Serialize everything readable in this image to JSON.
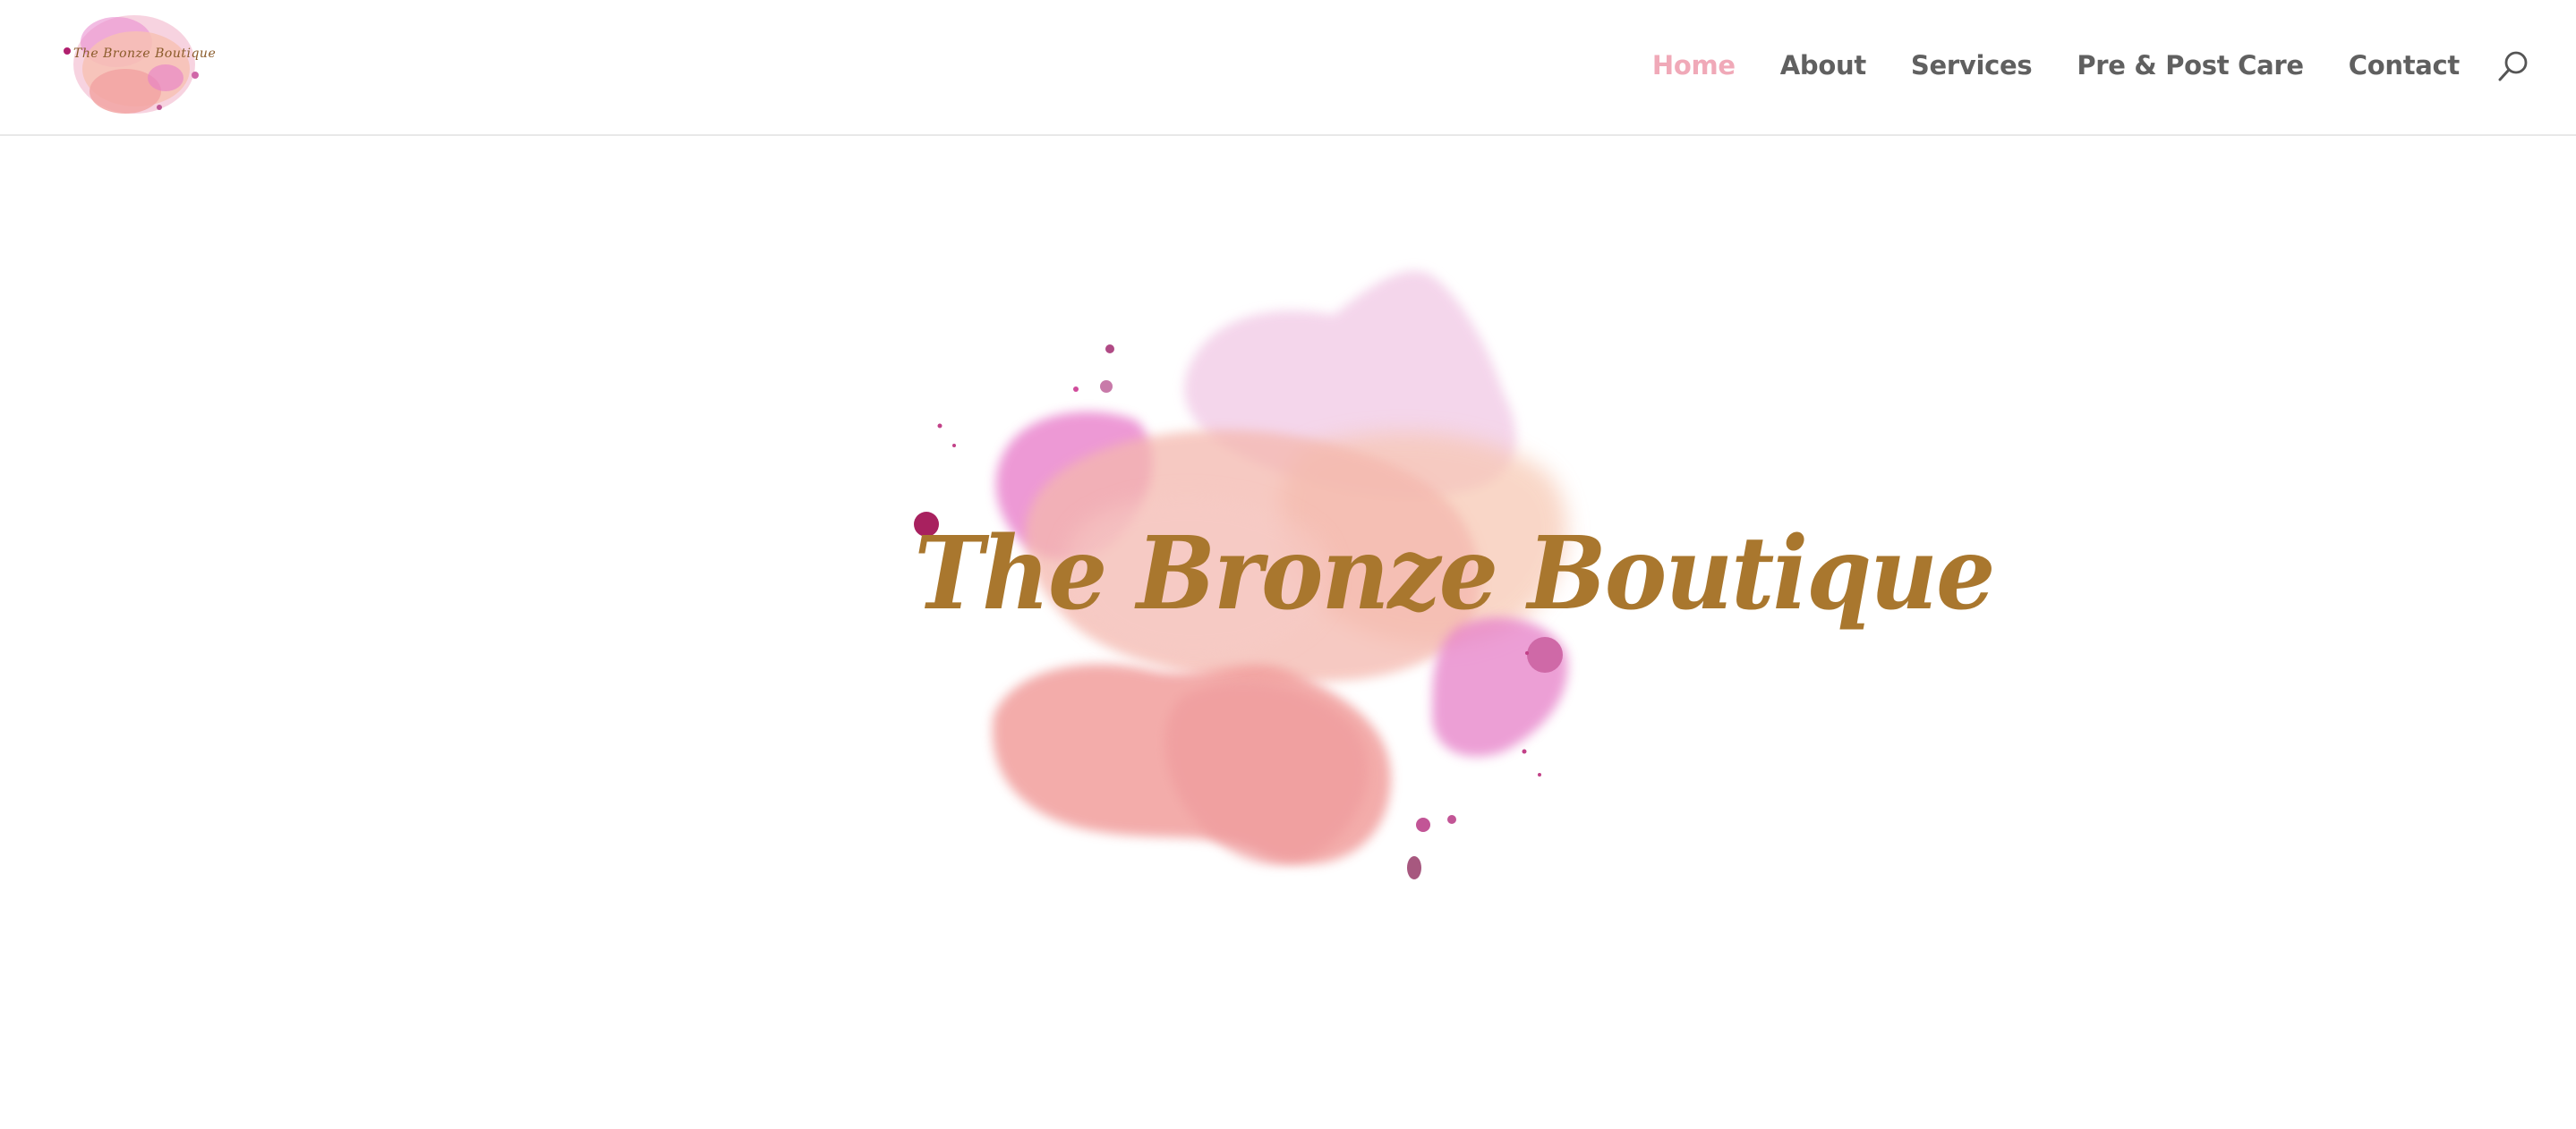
{
  "site": {
    "logo_text": "The Bronze Boutique"
  },
  "nav": {
    "items": [
      {
        "label": "Home",
        "active": true
      },
      {
        "label": "About",
        "active": false
      },
      {
        "label": "Services",
        "active": false
      },
      {
        "label": "Pre & Post Care",
        "active": false
      },
      {
        "label": "Contact",
        "active": false
      }
    ],
    "search_icon": "search-icon"
  },
  "hero": {
    "brand_text": "The Bronze Boutique"
  },
  "colors": {
    "nav_active": "#f0a9b8",
    "nav_text": "#606060",
    "brand_gold": "#a9772e",
    "splash_pink": "#f2a4a4",
    "splash_magenta": "#e37cc8",
    "splash_peach": "#f7c4b0"
  }
}
